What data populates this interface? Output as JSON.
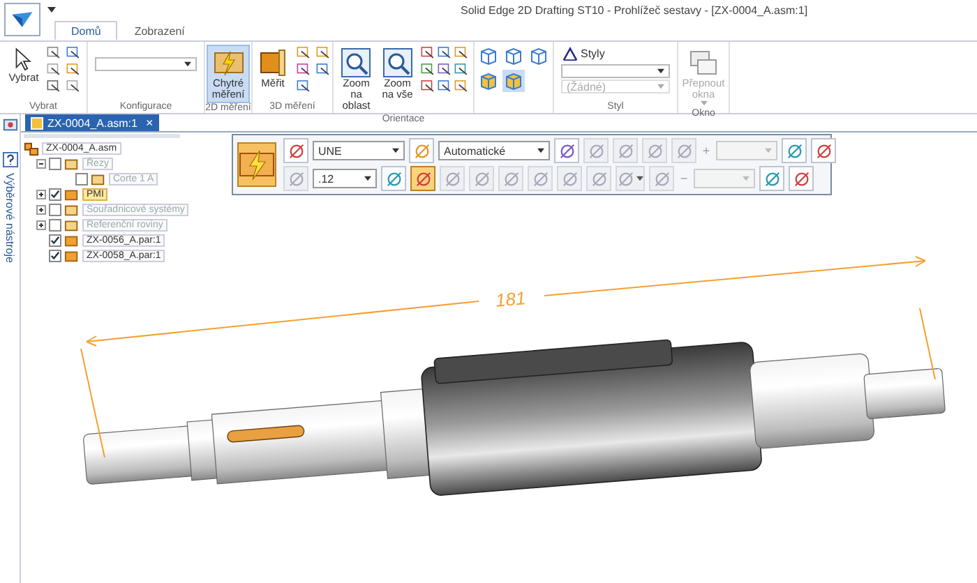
{
  "window": {
    "title": "Solid Edge 2D Drafting ST10 - Prohlížeč sestavy - [ZX-0004_A.asm:1]"
  },
  "tabs": [
    {
      "label": "Domů",
      "selected": true
    },
    {
      "label": "Zobrazení",
      "selected": false
    }
  ],
  "ribbon": [
    {
      "kind": "select",
      "label": "Vybrat",
      "button": {
        "label": "Vybrat"
      }
    },
    {
      "kind": "config",
      "label": "Konfigurace"
    },
    {
      "kind": "measure2d",
      "label": "2D měření",
      "button": {
        "label": "Chytré měření",
        "selected": true
      }
    },
    {
      "kind": "measure3d",
      "label": "3D měření",
      "button": {
        "label": "Měřit"
      }
    },
    {
      "kind": "orientation",
      "label": "Orientace",
      "buttons": [
        {
          "label": "Zoom na oblast"
        },
        {
          "label": "Zoom na vše"
        }
      ]
    },
    {
      "kind": "views",
      "cubes": [
        {
          "selected": false
        },
        {
          "selected": false
        },
        {
          "selected": false
        },
        {
          "selected": false
        },
        {
          "selected": true
        }
      ]
    },
    {
      "kind": "style",
      "label": "Styl",
      "button": {
        "label": "Styly"
      },
      "second_dropdown": {
        "value": "(Žádné)",
        "disabled": true
      }
    },
    {
      "kind": "window",
      "label": "Okno",
      "button": {
        "label": "Přepnout okna",
        "disabled": true
      }
    }
  ],
  "document_tab": {
    "label": "ZX-0004_A.asm:1",
    "close": "×"
  },
  "side_panel": {
    "label": "Výběrové nástroje"
  },
  "tree": {
    "label": "ZX-0004_A.asm",
    "children": [
      {
        "label": "Řezy",
        "checked": false,
        "selected": false,
        "expanded": true,
        "children": [
          {
            "label": "Corte 1 A",
            "checked": false,
            "selected": false
          }
        ]
      },
      {
        "label": "PMI",
        "checked": true,
        "selected": true,
        "expanded": false
      },
      {
        "label": "Souřadnicové systémy",
        "checked": false,
        "selected": false,
        "expanded": false
      },
      {
        "label": "Referenční roviny",
        "checked": false,
        "selected": false,
        "expanded": false
      },
      {
        "label": "ZX-0056_A.par:1",
        "checked": true,
        "selected": false
      },
      {
        "label": "ZX-0058_A.par:1",
        "checked": true,
        "selected": false
      }
    ]
  },
  "toolbar": {
    "main_button": {
      "on": true
    },
    "rows": [
      [
        {
          "kind": "button",
          "on": false,
          "disabled": false
        },
        {
          "kind": "dropdown",
          "value": "UNE",
          "disabled": false
        },
        {
          "kind": "button",
          "on": false,
          "disabled": false
        },
        {
          "kind": "dropdown",
          "value": "Automatické",
          "disabled": false
        },
        {
          "kind": "button",
          "on": false,
          "disabled": false
        },
        {
          "kind": "button",
          "on": false,
          "disabled": true
        },
        {
          "kind": "button",
          "on": false,
          "disabled": true
        },
        {
          "kind": "button",
          "on": false,
          "disabled": true
        },
        {
          "kind": "button",
          "on": false,
          "disabled": true
        },
        {
          "kind": "sign",
          "text": "+"
        },
        {
          "kind": "dropdown",
          "disabled": true
        },
        {
          "kind": "button",
          "on": false,
          "disabled": false
        },
        {
          "kind": "button",
          "on": false,
          "disabled": false
        }
      ],
      [
        {
          "kind": "button",
          "on": false,
          "disabled": true
        },
        {
          "kind": "dropdown",
          "value": ".12",
          "disabled": false
        },
        {
          "kind": "button",
          "on": false,
          "disabled": false
        },
        {
          "kind": "button",
          "on": true,
          "disabled": false
        },
        {
          "kind": "button",
          "on": false,
          "disabled": true
        },
        {
          "kind": "button",
          "on": false,
          "disabled": true
        },
        {
          "kind": "button",
          "on": false,
          "disabled": true
        },
        {
          "kind": "button",
          "on": false,
          "disabled": true
        },
        {
          "kind": "button",
          "on": false,
          "disabled": true
        },
        {
          "kind": "button",
          "on": false,
          "disabled": true
        },
        {
          "kind": "split",
          "on": false,
          "disabled": true
        },
        {
          "kind": "button",
          "on": false,
          "disabled": true
        },
        {
          "kind": "sign",
          "text": "−"
        },
        {
          "kind": "dropdown",
          "disabled": true
        },
        {
          "kind": "button",
          "on": false,
          "disabled": false
        },
        {
          "kind": "button",
          "on": false,
          "disabled": false
        }
      ]
    ]
  },
  "canvas": {
    "dimension": {
      "value": "181"
    }
  }
}
